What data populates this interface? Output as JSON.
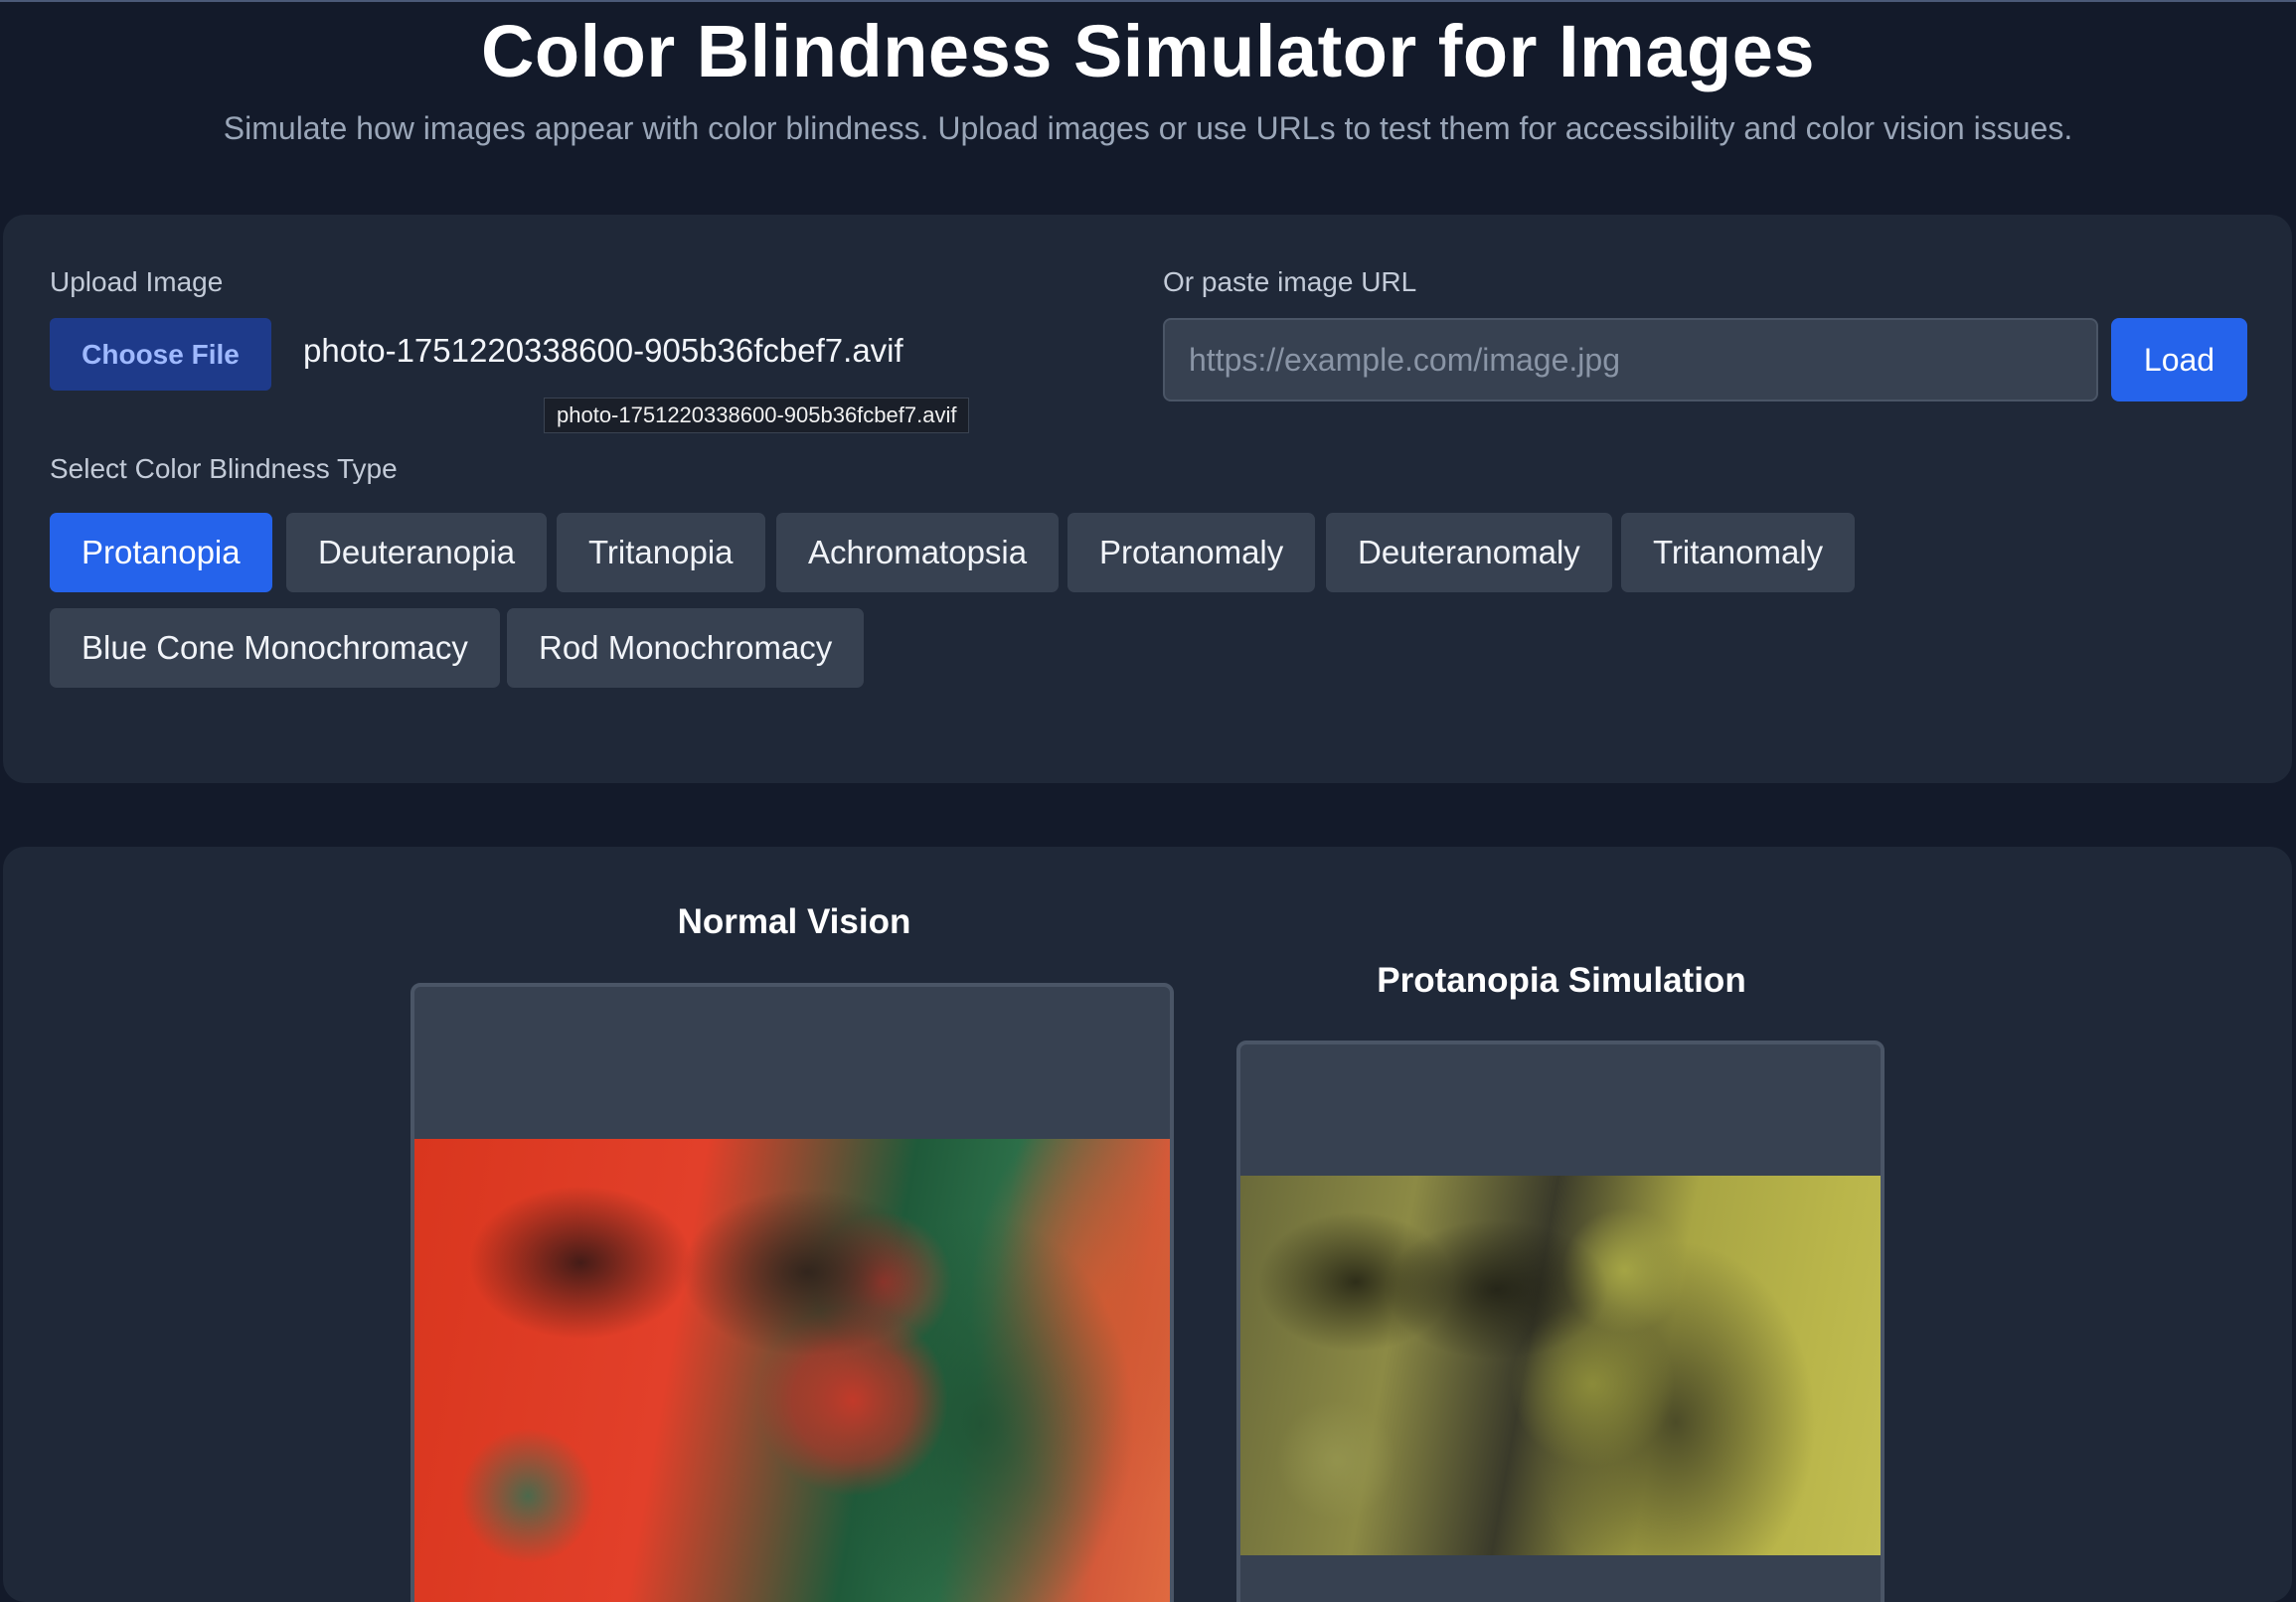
{
  "header": {
    "title": "Color Blindness Simulator for Images",
    "subtitle": "Simulate how images appear with color blindness. Upload images or use URLs to test them for accessibility and color vision issues."
  },
  "upload": {
    "label": "Upload Image",
    "choose_file_label": "Choose File",
    "file_name": "photo-1751220338600-905b36fcbef7.avif",
    "tooltip": "photo-1751220338600-905b36fcbef7.avif"
  },
  "url": {
    "label": "Or paste image URL",
    "placeholder": "https://example.com/image.jpg",
    "value": "",
    "load_label": "Load"
  },
  "types": {
    "label": "Select Color Blindness Type",
    "selected": "Protanopia",
    "items": [
      {
        "label": "Protanopia"
      },
      {
        "label": "Deuteranopia"
      },
      {
        "label": "Tritanopia"
      },
      {
        "label": "Achromatopsia"
      },
      {
        "label": "Protanomaly"
      },
      {
        "label": "Deuteranomaly"
      },
      {
        "label": "Tritanomaly"
      },
      {
        "label": "Blue Cone Monochromacy"
      },
      {
        "label": "Rod Monochromacy"
      }
    ]
  },
  "results": {
    "normal_title": "Normal Vision",
    "simulated_title": "Protanopia Simulation"
  },
  "colors": {
    "accent": "#2563eb",
    "background": "#131a2a",
    "panel": "#1f2838",
    "button": "#374151"
  }
}
